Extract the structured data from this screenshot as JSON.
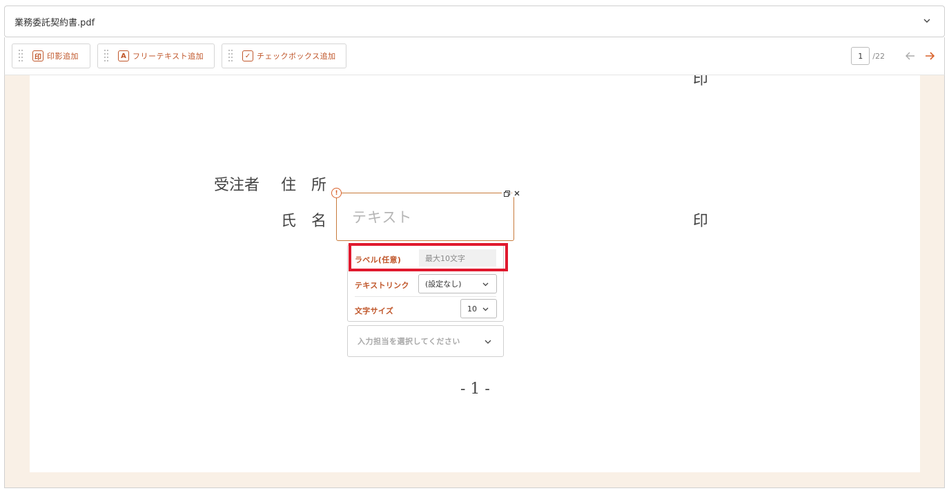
{
  "file_header": {
    "filename": "業務委託契約書.pdf"
  },
  "toolbar": {
    "buttons": [
      {
        "icon_text": "印",
        "label": "印影追加",
        "icon": "seal-icon"
      },
      {
        "icon_text": "A",
        "label": "フリーテキスト追加",
        "icon": "text-icon"
      },
      {
        "icon_text": "✓",
        "label": "チェックボックス追加",
        "icon": "checkbox-icon"
      }
    ],
    "pager": {
      "current_page": "1",
      "total": "/22"
    }
  },
  "document": {
    "top_seal": "印",
    "contractor_label": "受注者",
    "address_label": "住　所",
    "name_label": "氏　名",
    "seal_mark": "印",
    "page_number": "- 1 -"
  },
  "text_field": {
    "placeholder": "テキスト",
    "warning_icon_text": "!"
  },
  "properties": {
    "label_title": "ラベル(任意)",
    "label_placeholder": "最大10文字",
    "text_link_title": "テキストリンク",
    "text_link_value": "(設定なし)",
    "font_size_title": "文字サイズ",
    "font_size_value": "10"
  },
  "assignee": {
    "placeholder": "入力担当を選択してください"
  },
  "colors": {
    "accent": "#c0562a",
    "highlight": "#e0192e",
    "viewer_bg": "#f9f0e6"
  }
}
